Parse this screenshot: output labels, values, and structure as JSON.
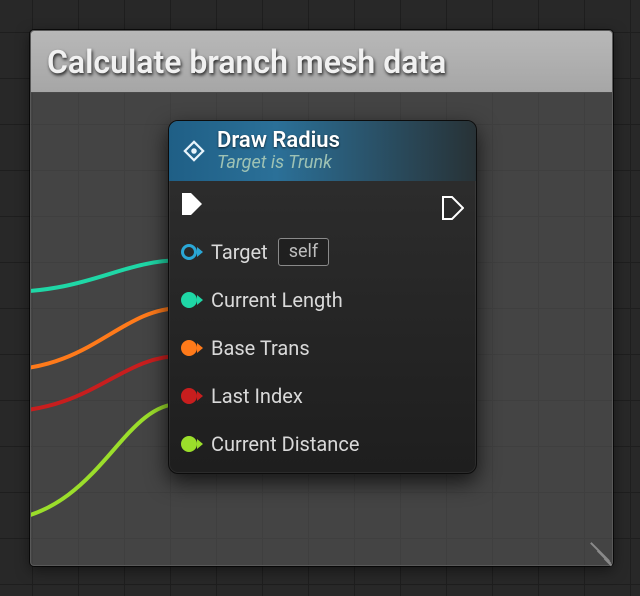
{
  "comment": {
    "title": "Calculate branch mesh data"
  },
  "node": {
    "title": "Draw Radius",
    "subtitle": "Target is Trunk",
    "pins": {
      "target": {
        "label": "Target",
        "color": "#2aa7d6",
        "connected": false,
        "default_label": "self"
      },
      "current_length": {
        "label": "Current Length",
        "color": "#1fd7a6",
        "connected": true
      },
      "base_trans": {
        "label": "Base Trans",
        "color": "#ff7a1a",
        "connected": true
      },
      "last_index": {
        "label": "Last Index",
        "color": "#c81e1e",
        "connected": true
      },
      "current_distance": {
        "label": "Current Distance",
        "color": "#9bde2b",
        "connected": true
      }
    }
  }
}
